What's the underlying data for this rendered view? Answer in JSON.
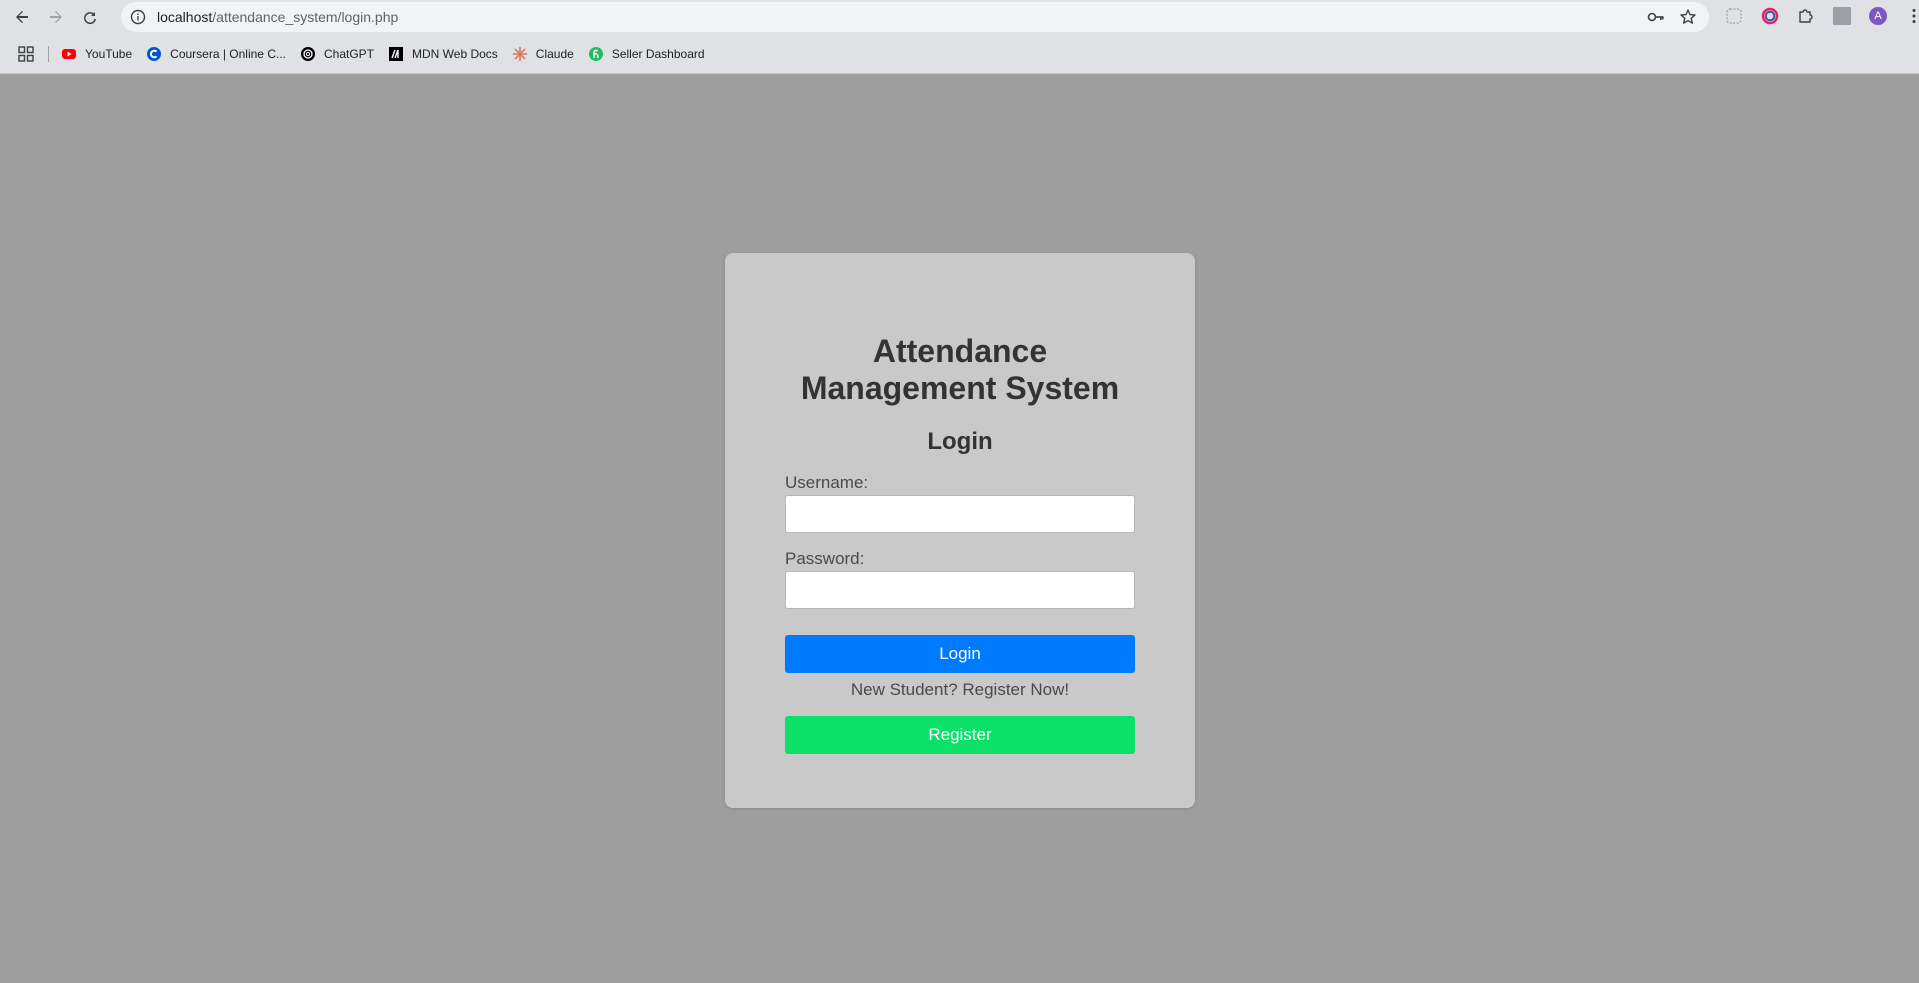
{
  "browser": {
    "url_host": "localhost",
    "url_path": "/attendance_system/login.php",
    "avatar_letter": "A",
    "bookmarks": [
      {
        "label": "YouTube",
        "icon": "youtube-icon",
        "color": "#ff0000"
      },
      {
        "label": "Coursera | Online C...",
        "icon": "coursera-icon",
        "color": "#0056d2"
      },
      {
        "label": "ChatGPT",
        "icon": "chatgpt-icon",
        "color": "#000000"
      },
      {
        "label": "MDN Web Docs",
        "icon": "mdn-icon",
        "color": "#000000"
      },
      {
        "label": "Claude",
        "icon": "claude-icon",
        "color": "#d97757"
      },
      {
        "label": "Seller Dashboard",
        "icon": "seller-dashboard-icon",
        "color": "#1fbf5f"
      }
    ]
  },
  "login": {
    "title": "Attendance Management System",
    "subtitle": "Login",
    "username_label": "Username:",
    "username_value": "",
    "password_label": "Password:",
    "password_value": "",
    "login_button": "Login",
    "register_note": "New Student? Register Now!",
    "register_button": "Register"
  },
  "colors": {
    "page_background": "#9e9e9e",
    "card_background": "#c9c9c9",
    "login_button": "#007bff",
    "register_button": "#0be068"
  }
}
